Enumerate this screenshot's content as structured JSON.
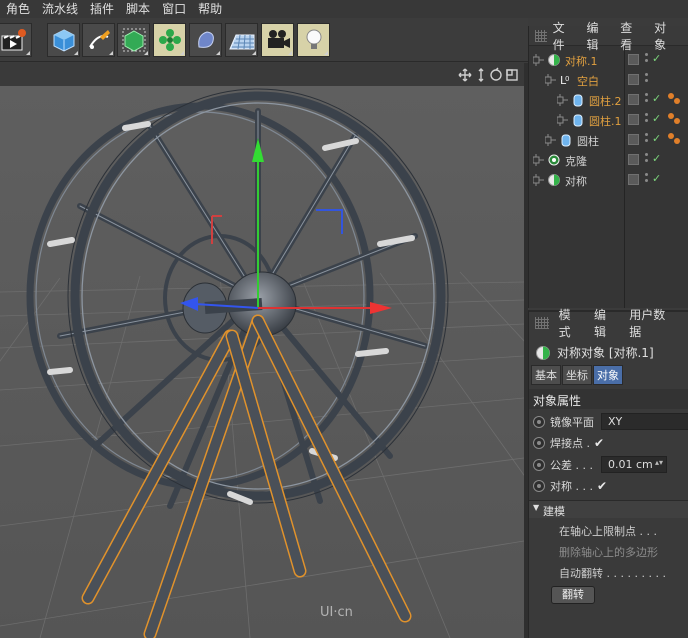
{
  "menubar": {
    "items": [
      "角色",
      "流水线",
      "插件",
      "脚本",
      "窗口",
      "帮助"
    ]
  },
  "toolbar": {
    "buttons": [
      {
        "name": "render-settings-icon",
        "active": false
      },
      {
        "name": "cube-icon",
        "active": false
      },
      {
        "name": "pen-icon",
        "active": false
      },
      {
        "name": "subdivision-icon",
        "active": false
      },
      {
        "name": "array-icon",
        "active": true
      },
      {
        "name": "deformer-icon",
        "active": false
      },
      {
        "name": "floor-icon",
        "active": false
      },
      {
        "name": "camera-icon",
        "active": true
      },
      {
        "name": "light-icon",
        "active": true
      }
    ]
  },
  "object_manager": {
    "menu": [
      "文件",
      "编辑",
      "查看",
      "对象"
    ],
    "rows": [
      {
        "label": "对称.1",
        "color": "#e0a040",
        "icon": "symmetry-icon",
        "indent": 0,
        "tags": false
      },
      {
        "label": "空白",
        "color": "#e0a040",
        "icon": "null-icon",
        "indent": 1,
        "tags": false
      },
      {
        "label": "圆柱.2",
        "color": "#e0a040",
        "icon": "cylinder-icon",
        "indent": 2,
        "tags": true
      },
      {
        "label": "圆柱.1",
        "color": "#e0a040",
        "icon": "cylinder-icon",
        "indent": 2,
        "tags": true
      },
      {
        "label": "圆柱",
        "color": "#d0d0d0",
        "icon": "cylinder-icon",
        "indent": 1,
        "tags": true
      },
      {
        "label": "克隆",
        "color": "#d0d0d0",
        "icon": "cloner-icon",
        "indent": 0,
        "tags": false
      },
      {
        "label": "对称",
        "color": "#d0d0d0",
        "icon": "symmetry-icon",
        "indent": 0,
        "tags": false
      }
    ]
  },
  "attributes": {
    "menu": [
      "模式",
      "编辑",
      "用户数据"
    ],
    "title": "对称对象 [对称.1]",
    "tabs": [
      {
        "label": "基本",
        "active": false
      },
      {
        "label": "坐标",
        "active": false
      },
      {
        "label": "对象",
        "active": true
      }
    ],
    "section_title": "对象属性",
    "props": {
      "mirror_plane_label": "镜像平面",
      "mirror_plane_value": "XY",
      "weld_label": "焊接点 .",
      "tolerance_label": "公差 . . .",
      "tolerance_value": "0.01 cm",
      "symmetry_label": "对称 . . ."
    },
    "subsection": "建模",
    "subprops": [
      {
        "label": "在轴心上限制点 . . .",
        "dim": false
      },
      {
        "label": "删除轴心上的多边形",
        "dim": true
      },
      {
        "label": "自动翻转 . . . . . . . . .",
        "dim": false
      }
    ],
    "flip_button": "翻转"
  },
  "watermark": "UI·cn"
}
